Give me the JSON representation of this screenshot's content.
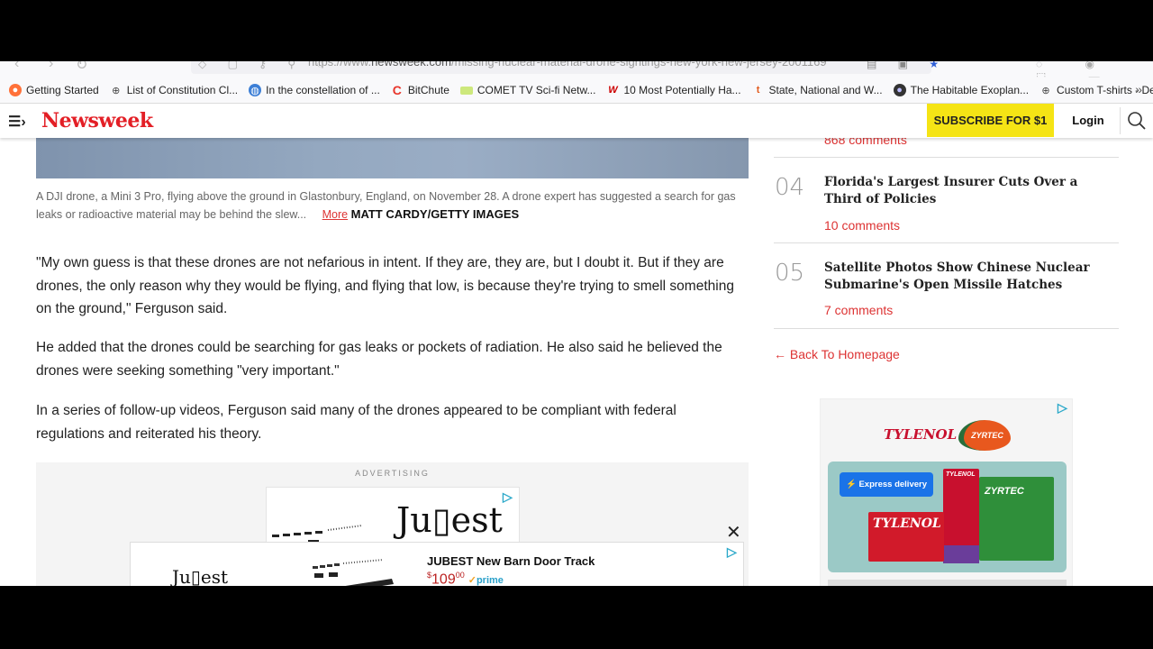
{
  "browser": {
    "url_prefix": "https://www.",
    "url_host": "newsweek.com",
    "url_path": "/missing-nuclear-material-drone-sightings-new-york-new-jersey-2001169",
    "bookmarks": [
      {
        "label": "Getting Started",
        "icon": "firefox-icon"
      },
      {
        "label": "List of Constitution Cl...",
        "icon": "globe-icon"
      },
      {
        "label": "In the constellation of ...",
        "icon": "globe-color-icon"
      },
      {
        "label": "BitChute",
        "icon": "bitchute-icon"
      },
      {
        "label": "COMET TV Sci-fi Netw...",
        "icon": "comet-icon"
      },
      {
        "label": "10 Most Potentially Ha...",
        "icon": "w-icon"
      },
      {
        "label": "State, National and W...",
        "icon": "t-icon"
      },
      {
        "label": "The Habitable Exoplan...",
        "icon": "exoplanet-icon"
      },
      {
        "label": "Custom T-shirts - Desi...",
        "icon": "globe-icon"
      }
    ],
    "bookmarks_more": "»"
  },
  "header": {
    "logo": "Newsweek",
    "subscribe_label": "SUBSCRIBE FOR $1",
    "login_label": "Login"
  },
  "article": {
    "caption": "A DJI drone, a Mini 3 Pro, flying above the ground in Glastonbury, England, on November 28. A drone expert has suggested a search for gas leaks or radioactive material may be behind the slew...",
    "caption_more": "More",
    "caption_credit": "MATT CARDY/GETTY IMAGES",
    "paragraphs": [
      "\"My own guess is that these drones are not nefarious in intent. If they are, they are, but I doubt it. But if they are drones, the only reason why they would be flying, and flying that low, is because they're trying to smell something on the ground,\" Ferguson said.",
      "He added that the drones could be searching for gas leaks or pockets of radiation. He also said he believed the drones were seeking something \"very important.\"",
      "In a series of follow-up videos, Ferguson said many of the drones appeared to be compliant with federal regulations and reiterated his theory."
    ],
    "ad_label": "ADVERTISING",
    "ad_brand": "Ju▯est"
  },
  "sticky_ad": {
    "brand": "Ju▯est",
    "product_title": "JUBEST New Barn Door Track",
    "price_currency": "$",
    "price_whole": "109",
    "price_cents": "00",
    "prime_label": "prime"
  },
  "sidebar": {
    "top_comments": "868 comments",
    "stories": [
      {
        "rank": "04",
        "title": "Florida's Largest Insurer Cuts Over a Third of Policies",
        "comments": "10 comments"
      },
      {
        "rank": "05",
        "title": "Satellite Photos Show Chinese Nuclear Submarine's Open Missile Hatches",
        "comments": "7 comments"
      }
    ],
    "back_link": "← Back To Homepage"
  },
  "side_ad": {
    "brand1": "TYLENOL",
    "brand2": "ZYRTEC",
    "express_label": "⚡ Express delivery",
    "box_red": "TYLENOL",
    "box_kids": "TYLENOL",
    "box_green": "ZYRTEC"
  },
  "colors": {
    "brand_red": "#e31f26",
    "subscribe_yellow": "#f5e415",
    "link_red": "#d33333"
  }
}
